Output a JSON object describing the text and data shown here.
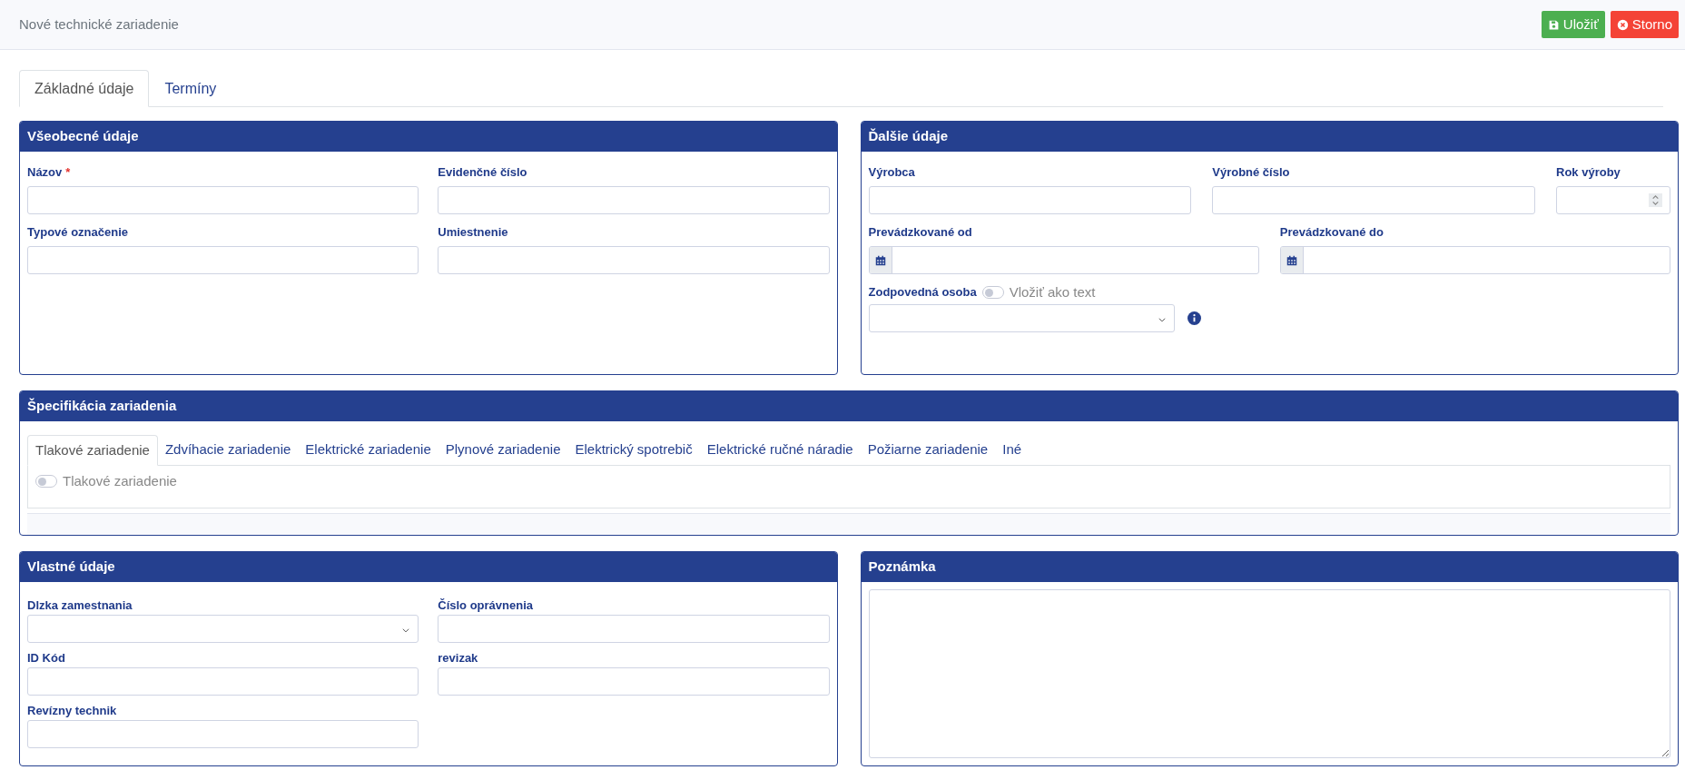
{
  "header": {
    "title": "Nové technické zariadenie",
    "buttons": [
      {
        "label": "Uložiť",
        "kind": "save"
      },
      {
        "label": "Storno",
        "kind": "cancel"
      }
    ]
  },
  "tabs": [
    {
      "label": "Základné údaje",
      "selected": true
    },
    {
      "label": "Termíny",
      "selected": false
    }
  ],
  "general": {
    "title": "Všeobecné údaje",
    "required_mark": "*",
    "fields": [
      {
        "label": "Názov",
        "required": true,
        "kind": "text"
      },
      {
        "label": "Evidenčné číslo",
        "required": false,
        "kind": "text"
      },
      {
        "label": "Typové označenie",
        "required": false,
        "kind": "text"
      },
      {
        "label": "Umiestnenie",
        "required": false,
        "kind": "text"
      }
    ]
  },
  "additional": {
    "title": "Ďalšie údaje",
    "rows": [
      [
        {
          "label": "Výrobca",
          "kind": "text"
        },
        {
          "label": "Výrobné číslo",
          "kind": "text"
        },
        {
          "label": "Rok výroby",
          "kind": "number"
        }
      ],
      [
        {
          "label": "Prevádzkované od",
          "kind": "date"
        },
        {
          "label": "Prevádzkované do",
          "kind": "date"
        }
      ]
    ],
    "responsible": {
      "label": "Zodpovedná osoba",
      "toggle": {
        "label": "Vložiť ako text",
        "on": false
      }
    }
  },
  "specification": {
    "title": "Špecifikácia zariadenia",
    "tabs": [
      {
        "label": "Tlakové zariadenie",
        "selected": true
      },
      {
        "label": "Zdvíhacie zariadenie",
        "selected": false
      },
      {
        "label": "Elektrické zariadenie",
        "selected": false
      },
      {
        "label": "Plynové zariadenie",
        "selected": false
      },
      {
        "label": "Elektrický spotrebič",
        "selected": false
      },
      {
        "label": "Elektrické ručné náradie",
        "selected": false
      },
      {
        "label": "Požiarne zariadenie",
        "selected": false
      },
      {
        "label": "Iné",
        "selected": false
      }
    ],
    "toggle": {
      "label": "Tlakové zariadenie",
      "on": false
    }
  },
  "own": {
    "title": "Vlastné údaje",
    "fields": [
      {
        "label": "Dlzka zamestnania",
        "kind": "select"
      },
      {
        "label": "Číslo oprávnenia",
        "kind": "text"
      },
      {
        "label": "ID Kód",
        "kind": "text"
      },
      {
        "label": "revizak",
        "kind": "text"
      },
      {
        "label": "Revízny technik",
        "kind": "text"
      }
    ]
  },
  "note": {
    "title": "Poznámka"
  }
}
